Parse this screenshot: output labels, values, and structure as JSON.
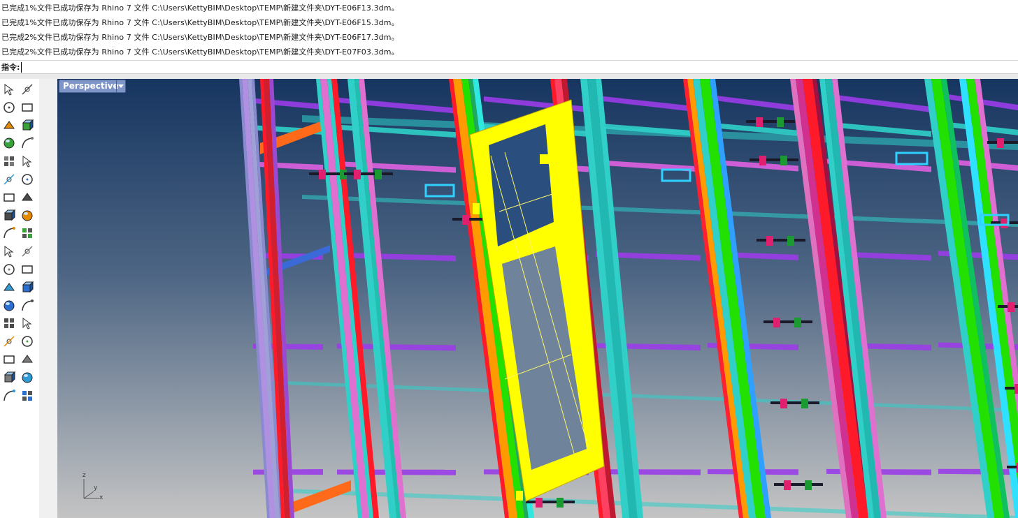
{
  "history": {
    "lines": [
      "已完成1%文件已成功保存为 Rhino 7 文件 C:\\Users\\KettyBIM\\Desktop\\TEMP\\新建文件夹\\DYT-E06F13.3dm。",
      "已完成1%文件已成功保存为 Rhino 7 文件 C:\\Users\\KettyBIM\\Desktop\\TEMP\\新建文件夹\\DYT-E06F15.3dm。",
      "已完成2%文件已成功保存为 Rhino 7 文件 C:\\Users\\KettyBIM\\Desktop\\TEMP\\新建文件夹\\DYT-E06F17.3dm。",
      "已完成2%文件已成功保存为 Rhino 7 文件 C:\\Users\\KettyBIM\\Desktop\\TEMP\\新建文件夹\\DYT-E07F03.3dm。"
    ]
  },
  "command": {
    "label": "指令:",
    "value": ""
  },
  "viewport": {
    "title": "Perspective",
    "menu_icon": "triangle-down-icon",
    "axis": {
      "z": "z",
      "y": "y",
      "x": "x"
    }
  },
  "toolbar": {
    "tools": [
      "select-pointer-icon",
      "point-icon",
      "polyline-icon",
      "curve-from-points-icon",
      "circle-icon",
      "ellipse-icon",
      "arc-icon",
      "rectangle-icon",
      "polygon-icon",
      "fillet-curve-icon",
      "surface-from-points-icon",
      "extrude-surface-icon",
      "box-solid-icon",
      "sphere-solid-icon",
      "cylinder-icon",
      "mesh-plane-icon",
      "gear-transform-icon",
      "explode-icon",
      "trim-icon",
      "split-icon",
      "boolean-union-icon",
      "boolean-split-icon",
      "fillet-edge-icon",
      "blend-curve-icon",
      "text-icon",
      "scale-icon",
      "group-icon",
      "mirror-icon",
      "block-icon",
      "dimension-icon",
      "array-icon",
      "layout-icon",
      "analyze-icon",
      "check-icon",
      "render-shaded-icon",
      "material-icon"
    ]
  },
  "colors": {
    "viewport_top": "#163560",
    "viewport_bottom": "#c4c4c4",
    "selected_panel": "#ffff00",
    "mullion_green": "#22e000",
    "mullion_cyan": "#30d0c8",
    "frame_red": "#ff1a2a",
    "bracket_pink": "#e0206e",
    "beam_purple": "#9a3ce8",
    "viewport_tab": "#7f95c8"
  }
}
